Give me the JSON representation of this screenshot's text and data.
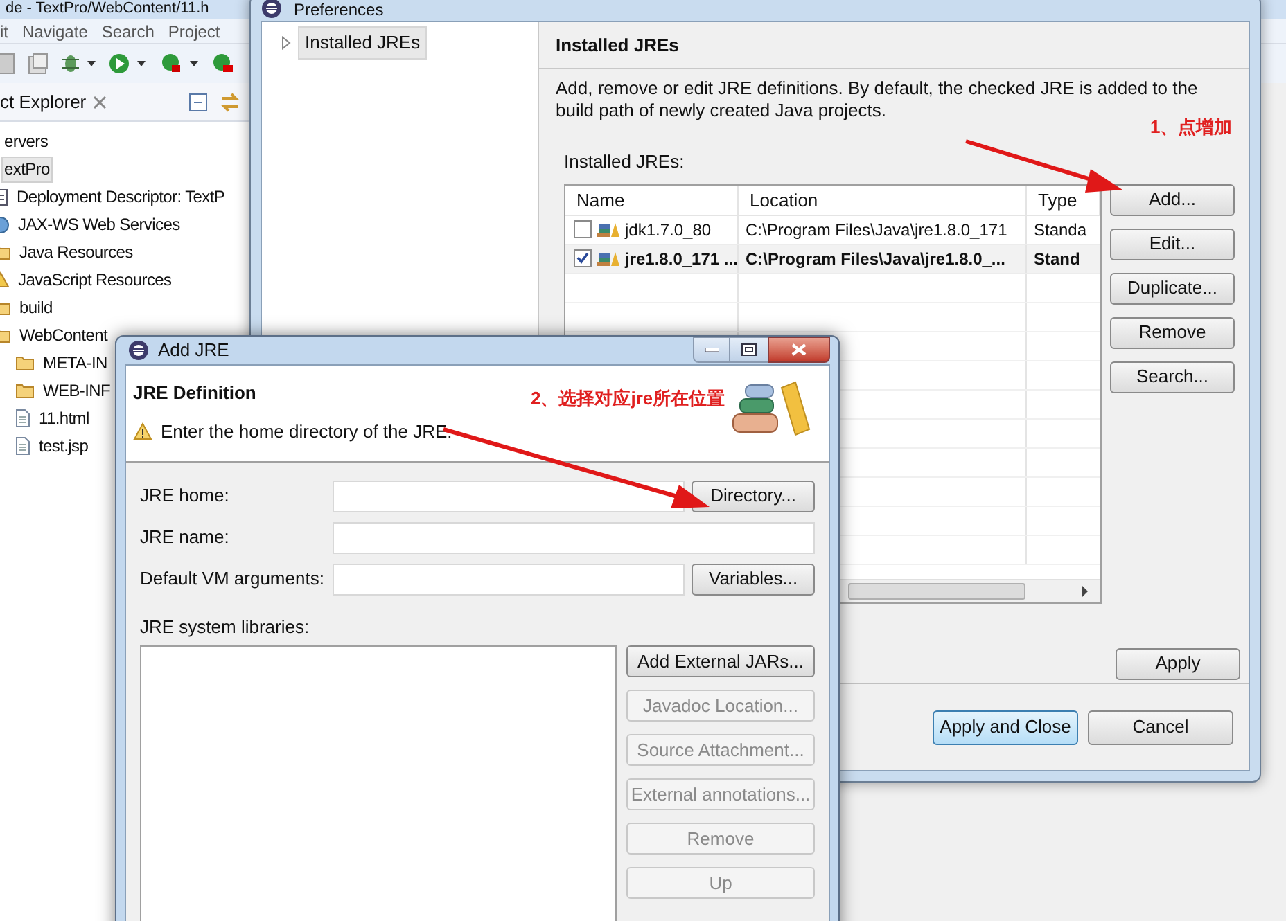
{
  "ide": {
    "title": "de - TextPro/WebContent/11.h",
    "menu": [
      "it",
      "Navigate",
      "Search",
      "Project"
    ],
    "explorer_tab": "ct Explorer",
    "tree": [
      {
        "label": "ervers",
        "selected": false
      },
      {
        "label": "extPro",
        "selected": true,
        "children": [
          {
            "label": "Deployment Descriptor: TextP",
            "kind": "descriptor",
            "selected": false
          },
          {
            "label": "JAX-WS Web Services",
            "kind": "service",
            "selected": false
          },
          {
            "label": "Java Resources",
            "kind": "folder",
            "selected": false
          },
          {
            "label": "JavaScript Resources",
            "kind": "script",
            "selected": false
          },
          {
            "label": "build",
            "kind": "folder",
            "selected": false
          },
          {
            "label": "WebContent",
            "kind": "folder",
            "selected": false,
            "children": [
              {
                "label": "META-IN",
                "kind": "folder",
                "selected": false
              },
              {
                "label": "WEB-INF",
                "kind": "folder",
                "selected": false
              },
              {
                "label": "11.html",
                "kind": "file",
                "selected": false
              },
              {
                "label": "test.jsp",
                "kind": "file",
                "selected": false
              }
            ]
          }
        ]
      }
    ]
  },
  "preferences": {
    "title": "Preferences",
    "nav": [
      {
        "label": "Installed JREs",
        "selected": true
      }
    ],
    "page_title": "Installed JREs",
    "description": "Add, remove or edit JRE definitions. By default, the checked JRE is added to the build path of newly created Java projects.",
    "table_label": "Installed JREs:",
    "columns": [
      "Name",
      "Location",
      "Type"
    ],
    "rows": [
      {
        "name": "jdk1.7.0_80",
        "location": "C:\\Program Files\\Java\\jre1.8.0_171",
        "type": "Standa",
        "checked": false
      },
      {
        "name": "jre1.8.0_171 ...",
        "location": "C:\\Program Files\\Java\\jre1.8.0_...",
        "type": "Stand",
        "checked": true
      }
    ],
    "side_buttons": [
      "Add...",
      "Edit...",
      "Duplicate...",
      "Remove",
      "Search..."
    ],
    "apply": "Apply",
    "footer_buttons": [
      {
        "label": "Apply and Close",
        "default": true
      },
      {
        "label": "Cancel",
        "default": false
      }
    ]
  },
  "add_jre": {
    "title": "Add JRE",
    "heading": "JRE Definition",
    "message": "Enter the home directory of the JRE.",
    "fields": [
      {
        "label": "JRE home:",
        "button": "Directory..."
      },
      {
        "label": "JRE name:"
      },
      {
        "label": "Default VM arguments:",
        "button": "Variables..."
      }
    ],
    "libraries_label": "JRE system libraries:",
    "library_buttons": [
      {
        "label": "Add External JARs...",
        "disabled": false
      },
      {
        "label": "Javadoc Location...",
        "disabled": true
      },
      {
        "label": "Source Attachment...",
        "disabled": true
      },
      {
        "label": "External annotations...",
        "disabled": true
      },
      {
        "label": "Remove",
        "disabled": true
      },
      {
        "label": "Up",
        "disabled": true
      }
    ]
  },
  "annotations": [
    {
      "text": "1、点增加"
    },
    {
      "text": "2、选择对应jre所在位置"
    }
  ]
}
